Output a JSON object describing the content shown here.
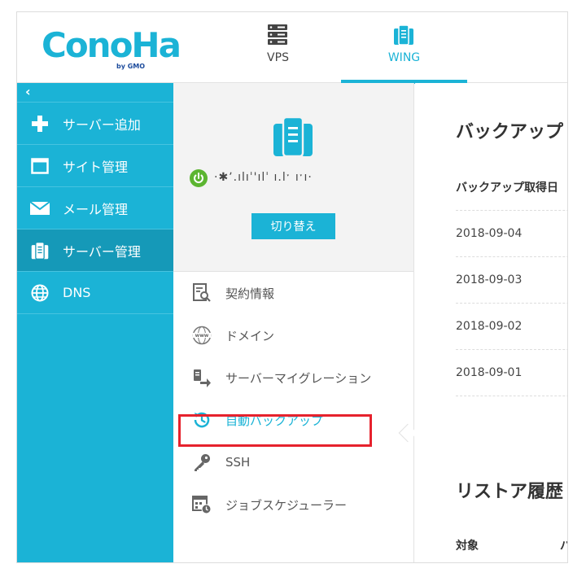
{
  "header": {
    "logo_text": "ConoHa",
    "logo_by": "by GMO",
    "tabs": [
      {
        "label": "VPS",
        "icon": "server-rack-icon"
      },
      {
        "label": "WING",
        "icon": "server-stack-icon",
        "active": true
      }
    ]
  },
  "sidebar": {
    "back": "‹",
    "items": [
      {
        "label": "サーバー追加",
        "icon": "plus-icon"
      },
      {
        "label": "サイト管理",
        "icon": "window-icon"
      },
      {
        "label": "メール管理",
        "icon": "mail-icon"
      },
      {
        "label": "サーバー管理",
        "icon": "server-icon",
        "active": true
      },
      {
        "label": "DNS",
        "icon": "globe-icon"
      }
    ]
  },
  "server": {
    "name": "·✱ʼ.ılıˈ'ılˈ ı.lˑ ıˑı·",
    "switch_label": "切り替え"
  },
  "menu": {
    "items": [
      {
        "label": "契約情報",
        "icon": "contract-info-icon"
      },
      {
        "label": "ドメイン",
        "icon": "www-icon"
      },
      {
        "label": "サーバーマイグレーション",
        "icon": "migration-icon"
      },
      {
        "label": "自動バックアップ",
        "icon": "backup-clock-icon",
        "active": true
      },
      {
        "label": "SSH",
        "icon": "key-icon"
      },
      {
        "label": "ジョブスケジューラー",
        "icon": "scheduler-icon"
      }
    ]
  },
  "backup": {
    "title": "バックアップ",
    "col_date": "バックアップ取得日",
    "rows": [
      "2018-09-04",
      "2018-09-03",
      "2018-09-02",
      "2018-09-01"
    ]
  },
  "restore": {
    "title": "リストア履歴",
    "col_target": "対象",
    "col_next": "バ"
  },
  "colors": {
    "accent": "#1bb3d6",
    "sidebar_active": "#1599b8",
    "highlight": "#e6222d",
    "power_on": "#5cb531"
  }
}
